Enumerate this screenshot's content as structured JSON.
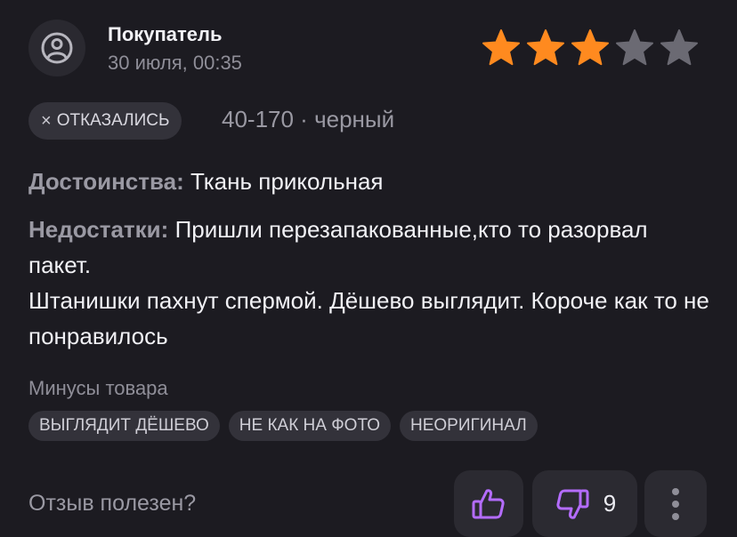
{
  "review": {
    "author": "Покупатель",
    "date": "30 июля, 00:35",
    "rating": 3,
    "rating_max": 5,
    "colors": {
      "star_filled": "#ff8a1f",
      "star_empty": "#6b6a73",
      "vote_icon": "#b46cff"
    },
    "status_chip": {
      "icon": "close-icon",
      "label": "ОТКАЗАЛИСЬ"
    },
    "variant": "40-170 · черный",
    "pros": {
      "label": "Достоинства:",
      "text": "Ткань прикольная"
    },
    "cons": {
      "label": "Недостатки:",
      "text": "Пришли перезапакованные,кто то разорвал пакет.\nШтанишки пахнут спермой. Дёшево выглядит. Короче как то не понравилось"
    },
    "minus_tags_label": "Минусы товара",
    "minus_tags": [
      "ВЫГЛЯДИТ ДЁШЕВО",
      "НЕ КАК НА ФОТО",
      "НЕОРИГИНАЛ"
    ],
    "helpful_question": "Отзыв полезен?",
    "dislike_count": "9"
  }
}
